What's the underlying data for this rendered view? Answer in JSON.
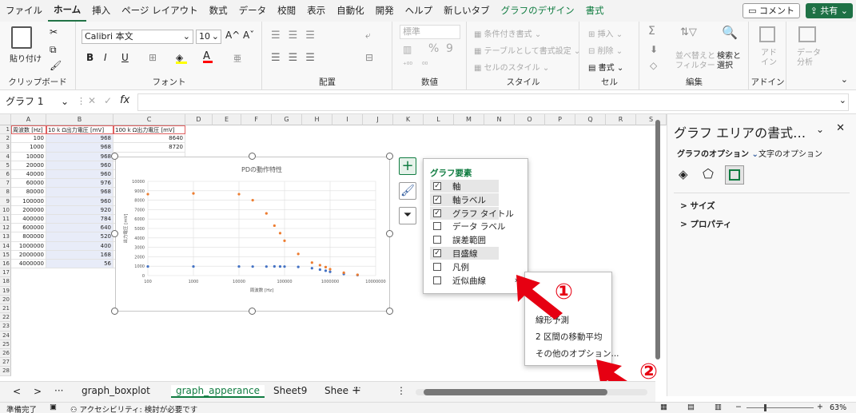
{
  "menu": {
    "tabs": [
      "ファイル",
      "ホーム",
      "挿入",
      "ページ レイアウト",
      "数式",
      "データ",
      "校閲",
      "表示",
      "自動化",
      "開発",
      "ヘルプ",
      "新しいタブ"
    ],
    "chart_tabs": [
      "グラフのデザイン",
      "書式"
    ],
    "comment_label": "コメント",
    "share_label": "共有"
  },
  "ribbon": {
    "clipboard": {
      "paste_label": "貼り付け",
      "group": "クリップボード"
    },
    "font": {
      "name": "Calibri 本文",
      "size": "10",
      "bold": "B",
      "italic": "I",
      "underline": "U",
      "grow": "A^",
      "shrink": "Aˇ",
      "group": "フォント"
    },
    "alignment": {
      "group": "配置"
    },
    "number": {
      "format": "標準",
      "percent": "%",
      "comma": "9",
      "group": "数値"
    },
    "style": {
      "conditional": "条件付き書式",
      "table": "テーブルとして書式設定",
      "cell_style": "セルのスタイル",
      "group": "スタイル"
    },
    "cells": {
      "insert": "挿入",
      "delete": "削除",
      "format": "書式",
      "group": "セル"
    },
    "editing": {
      "sum": "Σ",
      "sort": "並べ替えと\nフィルター",
      "find": "検索と\n選択",
      "group": "編集"
    },
    "addin": {
      "label": "アド\nイン",
      "group": "アドイン"
    },
    "analysis": {
      "label": "データ\n分析"
    }
  },
  "formula_bar": {
    "name_box": "グラフ 1",
    "fx": "fx",
    "cancel": "✕",
    "enter": "✓"
  },
  "columns": [
    "A",
    "B",
    "C",
    "D",
    "E",
    "F",
    "G",
    "H",
    "I",
    "J",
    "K",
    "L",
    "M",
    "N",
    "O",
    "P",
    "Q",
    "R",
    "S"
  ],
  "rows": [
    "1",
    "2",
    "3",
    "4",
    "5",
    "6",
    "7",
    "8",
    "9",
    "10",
    "11",
    "12",
    "13",
    "14",
    "15",
    "16",
    "17",
    "18",
    "19",
    "20",
    "21",
    "22",
    "23",
    "24",
    "25",
    "26",
    "27",
    "28"
  ],
  "table": {
    "headers": [
      "周波数 [Hz]",
      "10 k Ω出力電圧 [mV]",
      "100 k Ω出力電圧 [mV]"
    ],
    "rows": [
      [
        "100",
        "968",
        "8640"
      ],
      [
        "1000",
        "968",
        "8720"
      ],
      [
        "10000",
        "968",
        ""
      ],
      [
        "20000",
        "960",
        ""
      ],
      [
        "40000",
        "960",
        ""
      ],
      [
        "60000",
        "976",
        ""
      ],
      [
        "80000",
        "968",
        ""
      ],
      [
        "100000",
        "960",
        ""
      ],
      [
        "200000",
        "920",
        ""
      ],
      [
        "400000",
        "784",
        ""
      ],
      [
        "600000",
        "640",
        ""
      ],
      [
        "800000",
        "520",
        ""
      ],
      [
        "1000000",
        "400",
        ""
      ],
      [
        "2000000",
        "168",
        ""
      ],
      [
        "4000000",
        "56",
        ""
      ]
    ]
  },
  "chart_data": {
    "type": "scatter",
    "title": "PDの動作特性",
    "xlabel": "周波数 [Hz]",
    "ylabel": "出力電圧 [mV]",
    "x_scale": "log",
    "xlim": [
      100,
      10000000
    ],
    "ylim": [
      0,
      10000
    ],
    "x_ticks": [
      "100",
      "1000",
      "10000",
      "100000",
      "1000000",
      "10000000"
    ],
    "y_ticks": [
      "0",
      "1000",
      "2000",
      "3000",
      "4000",
      "5000",
      "6000",
      "7000",
      "8000",
      "9000",
      "10000"
    ],
    "grid": true,
    "series": [
      {
        "color": "#4472c4",
        "x": [
          100,
          1000,
          10000,
          20000,
          40000,
          60000,
          80000,
          100000,
          200000,
          400000,
          600000,
          800000,
          1000000,
          2000000,
          4000000
        ],
        "y": [
          968,
          968,
          968,
          960,
          960,
          976,
          968,
          960,
          920,
          784,
          640,
          520,
          400,
          168,
          56
        ]
      },
      {
        "color": "#ed7d31",
        "x": [
          100,
          1000,
          10000,
          20000,
          40000,
          60000,
          80000,
          100000,
          200000,
          400000,
          600000,
          800000,
          1000000,
          2000000,
          4000000
        ],
        "y": [
          8640,
          8720,
          8640,
          8000,
          6600,
          5300,
          4500,
          3700,
          2300,
          1380,
          1100,
          900,
          680,
          310,
          90
        ]
      }
    ]
  },
  "chart_elements": {
    "title": "グラフ要素",
    "items": [
      {
        "label": "軸",
        "checked": true
      },
      {
        "label": "軸ラベル",
        "checked": true
      },
      {
        "label": "グラフ タイトル",
        "checked": true
      },
      {
        "label": "データ ラベル",
        "checked": false
      },
      {
        "label": "誤差範囲",
        "checked": false
      },
      {
        "label": "目盛線",
        "checked": true
      },
      {
        "label": "凡例",
        "checked": false
      },
      {
        "label": "近似曲線",
        "checked": false
      }
    ]
  },
  "trend_submenu": {
    "items": [
      "線形予測",
      "2 区間の移動平均",
      "その他のオプション..."
    ]
  },
  "annotations": {
    "one": "①",
    "two": "②",
    "accent": "#e60012"
  },
  "format_pane": {
    "title": "グラフ エリアの書式…",
    "tab_graph": "グラフのオプション",
    "tab_text": "文字のオプション",
    "section_size": "サイズ",
    "section_props": "プロパティ"
  },
  "sheets": {
    "tabs": [
      "graph_boxplot",
      "graph_apperance",
      "Sheet9",
      "Shee"
    ],
    "active": "graph_apperance",
    "more": "···"
  },
  "status": {
    "ready": "準備完了",
    "accessibility": "アクセシビリティ: 検討が必要です",
    "zoom": "63%"
  },
  "colors": {
    "accent": "#217346",
    "share": "#1e7145"
  }
}
